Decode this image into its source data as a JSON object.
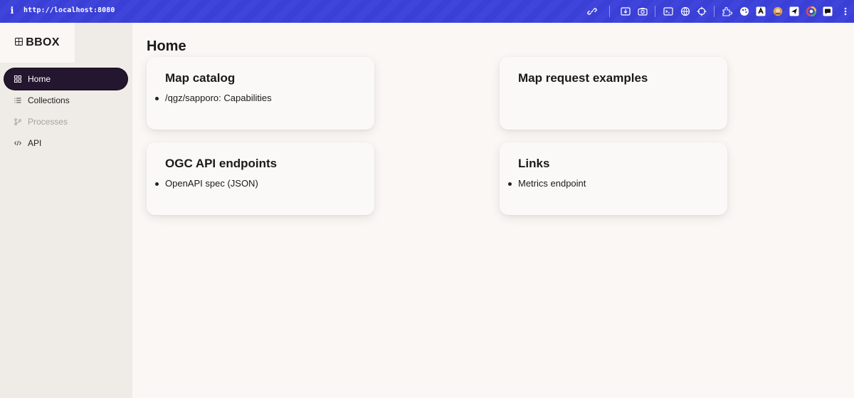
{
  "browser": {
    "url": "http://localhost:8080",
    "icons": [
      "link-icon",
      "download-icon",
      "camera-icon",
      "terminal-icon",
      "globe-icon",
      "crosshair-icon",
      "extension-icon",
      "palette-icon",
      "extension-dark-icon",
      "avatar-icon",
      "paper-plane-icon",
      "color-wheel-icon",
      "chat-icon"
    ]
  },
  "sidebar": {
    "logo": "BBOX",
    "items": [
      {
        "label": "Home",
        "icon": "grid-icon",
        "active": true
      },
      {
        "label": "Collections",
        "icon": "list-icon"
      },
      {
        "label": "Processes",
        "icon": "branch-icon",
        "disabled": true
      },
      {
        "label": "API",
        "icon": "code-icon"
      }
    ]
  },
  "main": {
    "title": "Home",
    "cards": [
      {
        "title": "Map catalog",
        "items": [
          "/qgz/sapporo: Capabilities"
        ]
      },
      {
        "title": "Map request examples",
        "items": []
      },
      {
        "title": "OGC API endpoints",
        "items": [
          "OpenAPI spec (JSON)"
        ]
      },
      {
        "title": "Links",
        "items": [
          "Metrics endpoint"
        ]
      }
    ]
  },
  "colors": {
    "topbar": "#3a3fd6",
    "active_nav": "#24162e",
    "sidebar_bg": "#efebe7",
    "page_bg": "#faf7f4"
  }
}
